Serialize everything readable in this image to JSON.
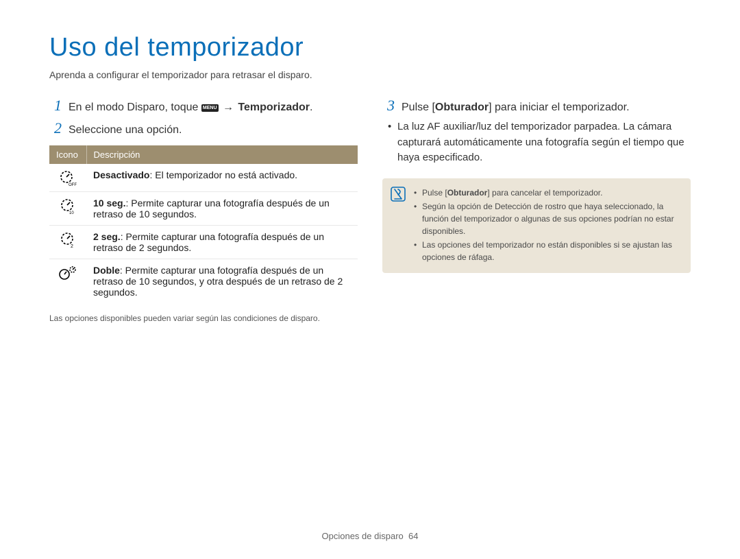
{
  "title": "Uso del temporizador",
  "subtitle": "Aprenda a configurar el temporizador para retrasar el disparo.",
  "left": {
    "step1_pre": "En el modo Disparo, toque ",
    "step1_menu": "MENU",
    "step1_arrow": "→",
    "step1_post": "Temporizador",
    "step1_end": ".",
    "step2": "Seleccione una opción.",
    "table": {
      "h1": "Icono",
      "h2": "Descripción",
      "rows": [
        {
          "b": "Desactivado",
          "t": ": El temporizador no está activado."
        },
        {
          "b": "10 seg.",
          "t": ": Permite capturar una fotografía después de un retraso de 10 segundos."
        },
        {
          "b": "2 seg.",
          "t": ": Permite capturar una fotografía después de un retraso de 2 segundos."
        },
        {
          "b": "Doble",
          "t": ": Permite capturar una fotografía después de un retraso de 10 segundos, y otra después de un retraso de 2 segundos."
        }
      ]
    },
    "note": "Las opciones disponibles pueden variar según las condiciones de disparo."
  },
  "right": {
    "step3_a": "Pulse [",
    "step3_b": "Obturador",
    "step3_c": "] para iniciar el temporizador.",
    "bullet": "La luz AF auxiliar/luz del temporizador parpadea. La cámara capturará automáticamente una fotografía según el tiempo que haya especificado.",
    "notes": {
      "n1a": "Pulse [",
      "n1b": "Obturador",
      "n1c": "] para cancelar el temporizador.",
      "n2": "Según la opción de Detección de rostro que haya seleccionado, la función del temporizador o algunas de sus opciones podrían no estar disponibles.",
      "n3": "Las opciones del temporizador no están disponibles si se ajustan las opciones de ráfaga."
    }
  },
  "footer": {
    "section": "Opciones de disparo",
    "page": "64"
  }
}
